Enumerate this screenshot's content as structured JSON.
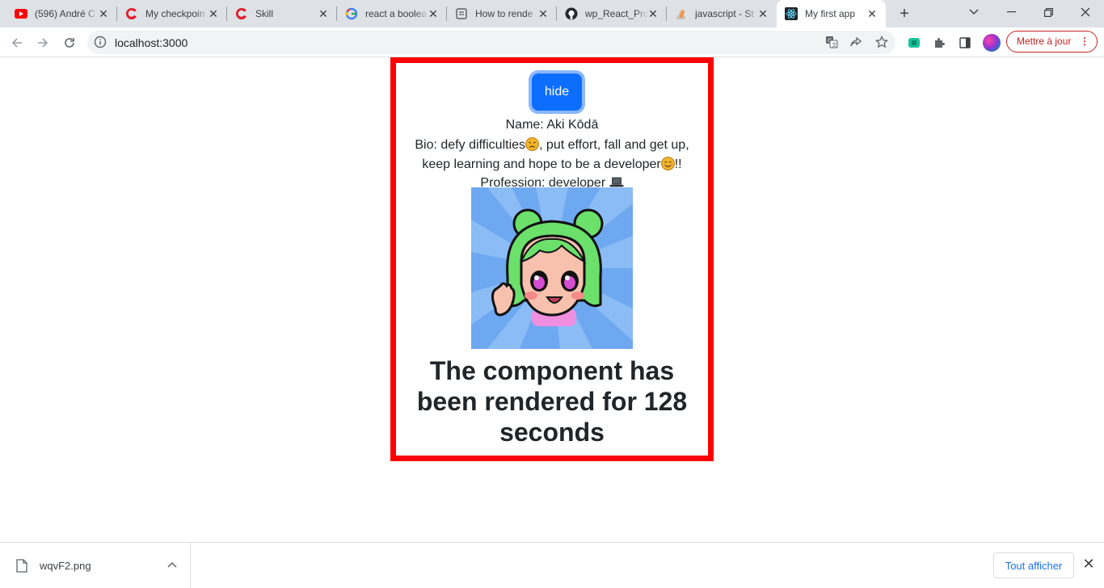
{
  "browser": {
    "tabs": [
      {
        "title": "(596) André C",
        "icon": "youtube-icon",
        "color": "#ff0000"
      },
      {
        "title": "My checkpoin",
        "icon": "gomycode-icon",
        "color": "#e11d2b"
      },
      {
        "title": "Skill",
        "icon": "gomycode-icon",
        "color": "#e11d2b"
      },
      {
        "title": "react a boolea",
        "icon": "google-icon",
        "color": "#4285f4"
      },
      {
        "title": "How to rende",
        "icon": "doc-icon",
        "color": "#5f6368"
      },
      {
        "title": "wp_React_Pro",
        "icon": "github-icon",
        "color": "#24292f"
      },
      {
        "title": "javascript - St",
        "icon": "stackoverflow-icon",
        "color": "#f48024"
      },
      {
        "title": "My first app",
        "icon": "react-icon",
        "color": "#61dafb"
      }
    ],
    "active_tab_index": 7,
    "url": "localhost:3000",
    "update_button_label": "Mettre à jour",
    "accent_red": "#c5221f"
  },
  "profile": {
    "toggle_label": "hide",
    "name_line": "Name: Aki Kōdā",
    "bio_part1": "Bio: defy difficulties",
    "bio_part2": ", put effort, fall and get up, keep learning and hope to be a developer",
    "bio_part3": "!!",
    "profession_line": "Profession: developer",
    "avatar_alt": "anime avatar with green hair",
    "timer_text": "The component has been rendered for 128 seconds",
    "border_color": "#ff0000",
    "button_color": "#0d6efd"
  },
  "downloads": {
    "filename": "wqvF2.png",
    "show_all_label": "Tout afficher"
  }
}
